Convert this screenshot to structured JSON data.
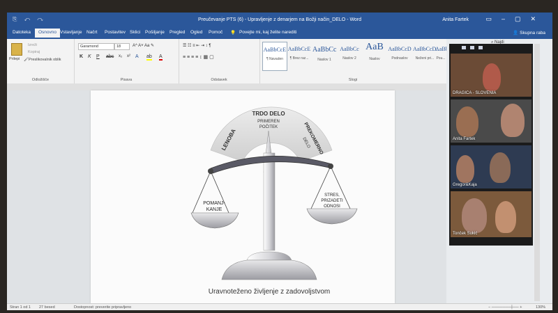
{
  "window": {
    "title": "Preučevanje PTS (6) - Upravljenje z denarjem na Božji način_DELO  -  Word",
    "user": "Anita Fartek"
  },
  "tabs": [
    {
      "label": "Datoteka"
    },
    {
      "label": "Osnovno",
      "active": true
    },
    {
      "label": "Vstavljanje"
    },
    {
      "label": "Načrt"
    },
    {
      "label": "Postavitev"
    },
    {
      "label": "Sklici"
    },
    {
      "label": "Pošiljanje"
    },
    {
      "label": "Pregled"
    },
    {
      "label": "Ogled"
    },
    {
      "label": "Pomoč"
    }
  ],
  "tell_me": "Povejte mi, kaj želite narediti",
  "share": "Skupna raba",
  "ribbon": {
    "clipboard": {
      "paste": "Prilepi",
      "cut": "Izreži",
      "copy": "Kopiraj",
      "format_painter": "Preslikovalnik oblik",
      "label": "Odložišče"
    },
    "font": {
      "name": "Garamond",
      "size": "18",
      "label": "Pisava"
    },
    "paragraph": {
      "label": "Odstavek"
    },
    "styles": {
      "label": "Slogi",
      "items": [
        {
          "sample": "AaBbCcE",
          "name": "¶ Navaden"
        },
        {
          "sample": "AaBbCcE",
          "name": "¶ Brez raz..."
        },
        {
          "sample": "AaBbCc",
          "name": "Naslov 1"
        },
        {
          "sample": "AaBbCc",
          "name": "Naslov 2"
        },
        {
          "sample": "AaB",
          "name": "Naslov"
        },
        {
          "sample": "AaBbCcD",
          "name": "Podnaslov"
        },
        {
          "sample": "AaBbCcD.",
          "name": "Neženi pri..."
        },
        {
          "sample": "AaBbCcD",
          "name": "Pou..."
        }
      ]
    },
    "find": "Najdi"
  },
  "document": {
    "arc_top": "TRDO DELO",
    "arc_top_sub1": "PRIMEREN",
    "arc_top_sub2": "POČITEK",
    "arc_left": "LENOBA",
    "arc_right1": "PREKOMERNO",
    "arc_right2": "DELO",
    "left_pan1": "POMANJ-",
    "left_pan2": "KANJE",
    "right_pan1": "STRES,",
    "right_pan2": "PRIZADETI",
    "right_pan3": "ODNOSI",
    "caption": "Uravnoteženo življenje z zadovoljstvom"
  },
  "status": {
    "page": "Stran 1 od 1",
    "words": "27 besed",
    "accessibility": "Dostopnost: preverite pripravljeno",
    "zoom": "130%"
  },
  "video": {
    "participants": [
      {
        "name": "DRAGICA - SLOVENIA"
      },
      {
        "name": "Anita Fartek"
      },
      {
        "name": "Gregor&Kaja"
      },
      {
        "name": "Tonček Sukić"
      }
    ]
  },
  "colors": {
    "word_blue": "#2b579a",
    "ribbon_bg": "#f3f3f3",
    "doc_bg": "#dfe2e5"
  }
}
